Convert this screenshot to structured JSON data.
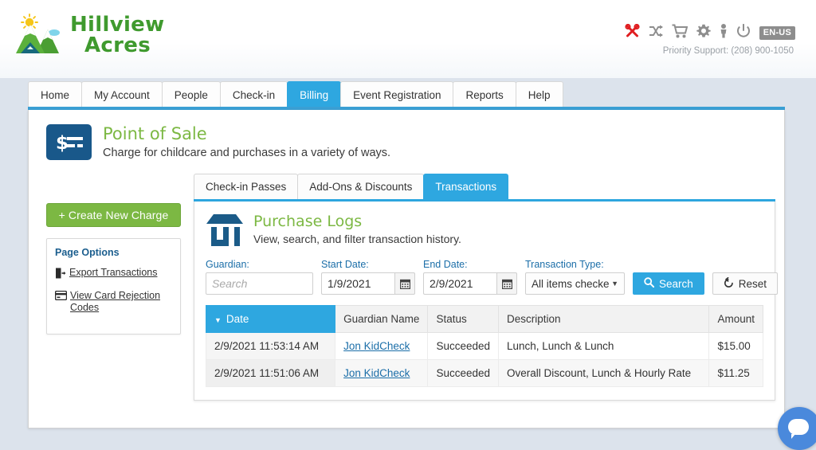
{
  "brand": {
    "line1": "Hillview",
    "line2": "Acres"
  },
  "header": {
    "icons": [
      "tools-icon",
      "shuffle-icon",
      "cart-icon",
      "gear-icon",
      "person-icon",
      "power-icon"
    ],
    "language_badge": "EN-US",
    "support_text": "Priority Support: (208) 900-1050"
  },
  "main_nav": {
    "tabs": [
      {
        "label": "Home",
        "active": false
      },
      {
        "label": "My Account",
        "active": false
      },
      {
        "label": "People",
        "active": false
      },
      {
        "label": "Check-in",
        "active": false
      },
      {
        "label": "Billing",
        "active": true
      },
      {
        "label": "Event Registration",
        "active": false
      },
      {
        "label": "Reports",
        "active": false
      },
      {
        "label": "Help",
        "active": false
      }
    ]
  },
  "page": {
    "icon": "dollar-card-icon",
    "title": "Point of Sale",
    "subtitle": "Charge for childcare and purchases in a variety of ways."
  },
  "sidebar": {
    "create_button": "+ Create New Charge",
    "options_title": "Page Options",
    "links": [
      {
        "label": "Export Transactions",
        "icon": "export-document-icon"
      },
      {
        "label": "View Card Rejection Codes",
        "icon": "credit-card-icon"
      }
    ]
  },
  "sub_tabs": [
    {
      "label": "Check-in Passes",
      "active": false
    },
    {
      "label": "Add-Ons & Discounts",
      "active": false
    },
    {
      "label": "Transactions",
      "active": true
    }
  ],
  "logs": {
    "icon": "storefront-icon",
    "title": "Purchase Logs",
    "subtitle": "View, search, and filter transaction history."
  },
  "filters": {
    "guardian_label": "Guardian:",
    "guardian_value": "",
    "guardian_placeholder": "Search",
    "start_label": "Start Date:",
    "start_value": "1/9/2021",
    "end_label": "End Date:",
    "end_value": "2/9/2021",
    "type_label": "Transaction Type:",
    "type_value": "All items checke",
    "search_button": "Search",
    "reset_button": "Reset"
  },
  "table": {
    "columns": [
      "Date",
      "Guardian Name",
      "Status",
      "Description",
      "Amount"
    ],
    "sorted_column": "Date",
    "sort_direction": "desc",
    "rows": [
      {
        "date": "2/9/2021 11:53:14 AM",
        "guardian": "Jon KidCheck",
        "status": "Succeeded",
        "description": "Lunch, Lunch & Lunch",
        "amount": "$15.00"
      },
      {
        "date": "2/9/2021 11:51:06 AM",
        "guardian": "Jon KidCheck",
        "status": "Succeeded",
        "description": "Overall Discount, Lunch & Hourly Rate",
        "amount": "$11.25"
      }
    ]
  },
  "colors": {
    "accent_blue": "#2ea7e0",
    "brand_green": "#7cb843",
    "dark_blue": "#19588a",
    "link_blue": "#1b6ea8",
    "page_bg": "#dce3ec"
  }
}
